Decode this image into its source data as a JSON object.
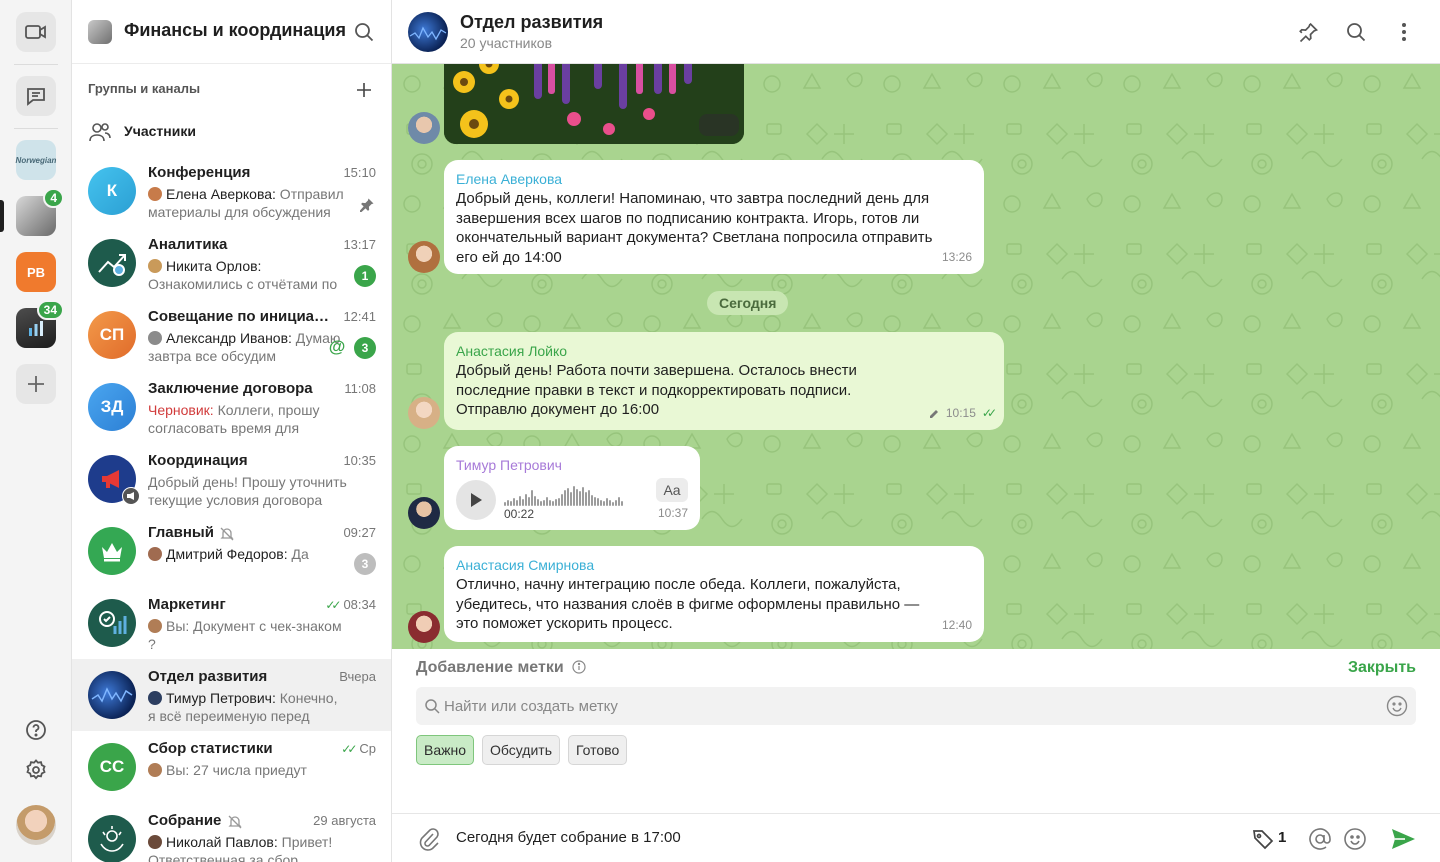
{
  "rail": {
    "workspaces": [
      {
        "name": "Norwegian",
        "badge": ""
      },
      {
        "name": "Finance",
        "badge": "4"
      },
      {
        "initials": "PB",
        "badge": ""
      },
      {
        "name": "Analytics",
        "badge": "34"
      }
    ]
  },
  "sidebar": {
    "org_title": "Финансы и координация",
    "section_title": "Группы и каналы",
    "members_label": "Участники",
    "chats": [
      {
        "name": "Конференция",
        "time": "15:10",
        "sender": "Елена Аверкова:",
        "preview": " Отправил материалы для обсуждения",
        "initials": "К",
        "pinned": true
      },
      {
        "name": "Аналитика",
        "time": "13:17",
        "sender": "Никита Орлов:",
        "preview": " Ознакомились с отчётами по",
        "unread": "1"
      },
      {
        "name": "Совещание по инициативе",
        "time": "12:41",
        "sender": "Александр Иванов:",
        "preview": " Думаю завтра все обсудим",
        "initials": "СП",
        "unread": "3",
        "mention": "@"
      },
      {
        "name": "Заключение договора",
        "time": "11:08",
        "draft": "Черновик:",
        "preview": " Коллеги, прошу согласовать время для встречи",
        "initials": "ЗД"
      },
      {
        "name": "Координация",
        "time": "10:35",
        "preview": "Добрый день! Прошу уточнить текущие условия договора"
      },
      {
        "name": "Главный",
        "time": "09:27",
        "sender": "Дмитрий Федоров:",
        "preview": " Да",
        "unread": "3"
      },
      {
        "name": "Маркетинг",
        "time": "08:34",
        "sender": "Вы:",
        "preview": " Документ с чек-знаком ?"
      },
      {
        "name": "Отдел развития",
        "time": "Вчера",
        "sender": "Тимур Петрович:",
        "preview": " Конечно, я всё переименую перед отправкой"
      },
      {
        "name": "Сбор статистики",
        "time": "Ср",
        "sender": "Вы:",
        "preview": " 27 числа приедут",
        "initials": "СС"
      },
      {
        "name": "Собрание",
        "time": "29 августа",
        "sender": "Николай Павлов:",
        "preview": " Привет! Ответственная за сбор"
      }
    ]
  },
  "conversation": {
    "title": "Отдел развития",
    "subtitle": "20 участников",
    "date_separator": "Сегодня",
    "messages": [
      {
        "sender": "Елена Аверкова",
        "sender_color": "#3bb0d6",
        "text": "Добрый день, коллеги! Напоминаю, что завтра последний день для завершения всех шагов по подписанию контракта. Игорь, готов ли окончательный вариант документа? Светлана попросила отправить его ей до 14:00",
        "time": "13:26"
      },
      {
        "sender": "Анастасия Лойко",
        "sender_color": "#3aa54a",
        "text": "Добрый день! Работа почти завершена. Осталось внести последние правки в текст и подкорректировать подписи. Отправлю документ до 16:00",
        "time": "10:15"
      },
      {
        "sender": "Тимур Петрович",
        "sender_color": "#a77ad8",
        "duration": "00:22",
        "transcribe": "Aa",
        "time": "10:37"
      },
      {
        "sender": "Анастасия Смирнова",
        "sender_color": "#3bb0d6",
        "text": "Отлично, начну интеграцию после обеда. Коллеги, пожалуйста, убедитесь, что названия слоёв в фигме оформлены правильно — это поможет ускорить процесс.",
        "time": "12:40"
      }
    ]
  },
  "tag_panel": {
    "title": "Добавление метки",
    "close_label": "Закрыть",
    "search_placeholder": "Найти или создать метку",
    "chips": [
      "Важно",
      "Обсудить",
      "Готово"
    ]
  },
  "composer": {
    "text": "Сегодня будет собрание в 17:00",
    "tag_count": "1"
  },
  "colors": {
    "accent": "#3aa54a",
    "chat_background": "#a9d48f",
    "outgoing_bubble": "#e9f8d5"
  }
}
